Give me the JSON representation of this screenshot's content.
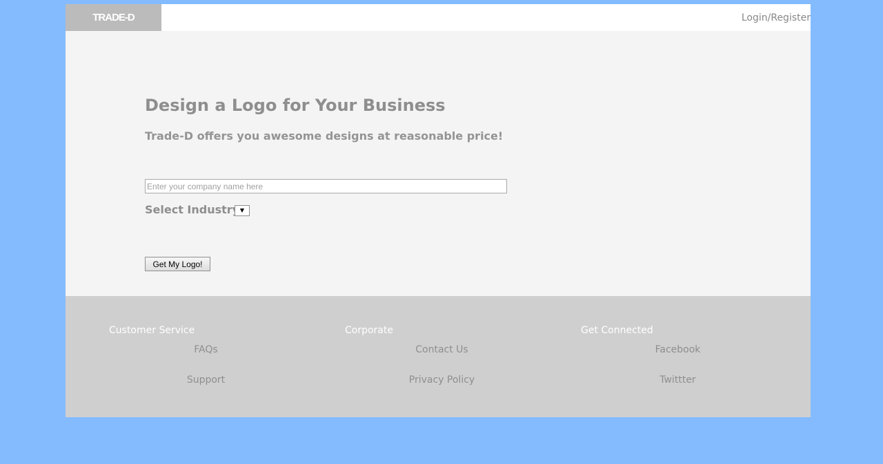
{
  "header": {
    "logo_text": "TRADE-D",
    "login_label": "Login/Register"
  },
  "hero": {
    "title": "Design a Logo for Your Business",
    "subtitle": "Trade-D offers you awesome designs at reasonable price!",
    "company_input": {
      "value": "",
      "placeholder": "Enter your company name here"
    },
    "industry_label": "Select Industry:",
    "industry_select": {
      "selected": "",
      "icon": "dropdown-arrow"
    },
    "submit_label": "Get My Logo!"
  },
  "footer": {
    "columns": [
      {
        "heading": "Customer Service",
        "links": [
          "FAQs",
          "Support"
        ]
      },
      {
        "heading": "Corporate",
        "links": [
          "Contact Us",
          "Privacy Policy"
        ]
      },
      {
        "heading": "Get Connected",
        "links": [
          "Facebook",
          "Twittter"
        ]
      }
    ]
  },
  "colors": {
    "background": "#84bbfe",
    "logo_bg": "#bbbbbb",
    "hero_bg": "#f4f4f4",
    "footer_bg": "#cfcfcf",
    "text_gray": "#8e8e8e",
    "footer_heading": "#ffffff"
  }
}
